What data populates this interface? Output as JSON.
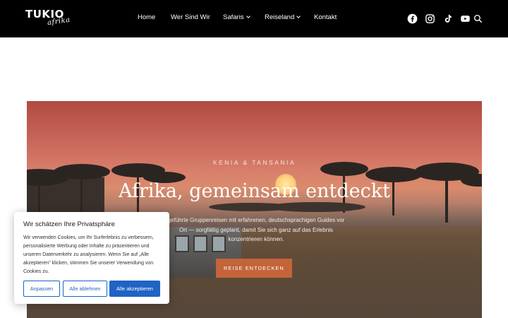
{
  "header": {
    "logo_main": "TUKIO",
    "logo_sub": "afrika",
    "nav": [
      {
        "label": "Home",
        "dropdown": false
      },
      {
        "label": "Wer Sind Wir",
        "dropdown": false
      },
      {
        "label": "Safaris",
        "dropdown": true
      },
      {
        "label": "Reiseland",
        "dropdown": true
      },
      {
        "label": "Kontakt",
        "dropdown": false
      }
    ],
    "icons": [
      "facebook-icon",
      "instagram-icon",
      "tiktok-icon",
      "youtube-icon",
      "search-icon"
    ]
  },
  "hero": {
    "kicker": "KENIA & TANSANIA",
    "title": "Afrika, gemeinsam entdeckt",
    "description_partial": "geführte Gruppenreisen mit erfahrenen, deutschsprachigen Guides vor Ort — sorgfältig geplant, damit Sie sich ganz auf das Erlebnis konzentrieren können.",
    "button": "REISE ENTDECKEN"
  },
  "cookie": {
    "title": "Wir schätzen Ihre Privatsphäre",
    "text": "Wir verwenden Cookies, um Ihr Surferlebnis zu verbessern, personalisierte Werbung oder Inhalte zu präsentieren und unseren Datenverkehr zu analysieren. Wenn Sie auf „Alle akzeptieren\" klicken, stimmen Sie unserer Verwendung von Cookies zu.",
    "customize": "Anpassen",
    "reject": "Alle ablehnen",
    "accept": "Alle akzeptieren"
  },
  "colors": {
    "header_bg": "#000000",
    "accent_button": "#c3643a",
    "cookie_blue": "#1f63c5"
  }
}
